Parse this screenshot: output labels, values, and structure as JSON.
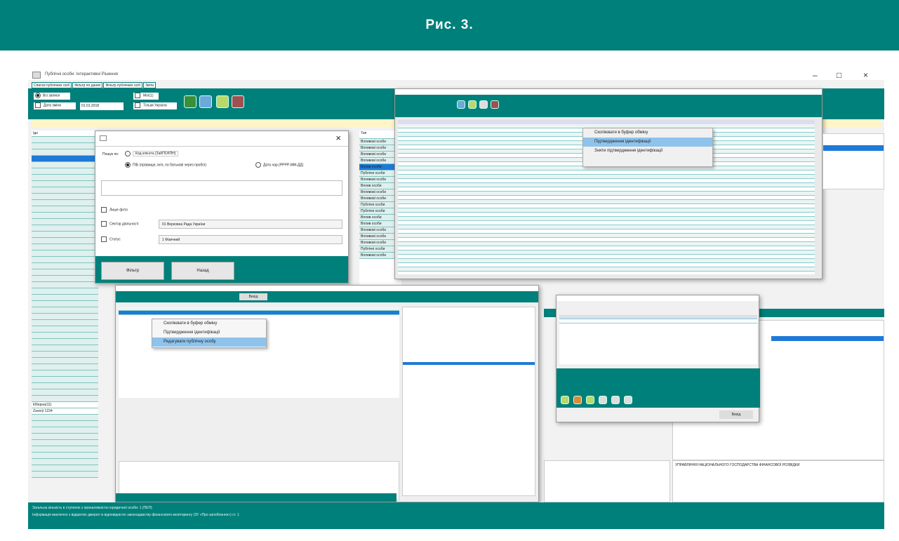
{
  "header": {
    "title": "Рис. 3."
  },
  "app": {
    "title": "Публічні особи: Інтерактивні Рішення",
    "window_controls": [
      "–",
      "□",
      "×"
    ],
    "tabs": [
      "Список публічних осіб",
      "Фільтр по даних",
      "Фільтр публічних осіб",
      "Звіти"
    ],
    "toolbar": {
      "radio_all": "Всі записи",
      "radio_date": "Дата зміни",
      "date_value": "01.01.2018",
      "check_sanc": "Мої(1)",
      "check_ukr": "Тільки Україна"
    },
    "list_header": "Ідн",
    "list_extra": [
      "Кіберна(11)",
      "Zaverj/ 1234"
    ],
    "status_lines": [
      "Загальна кількість в ступенях з приналежністю юридичної особи: 1 (ПЕП)",
      "Інформація виключно з відкритих джерел із відповідністю законодавству фінансового моніторингу (ЗУ «Про запобігання») ст. 1"
    ]
  },
  "filter_dialog": {
    "search_label": "Пошук по:",
    "opt_code": "Код клієнта (ЗаКПО/ІПН)",
    "opt_name": "ПІБ (прізвище, ім'я, по батькові через пробіл)",
    "opt_birth": "Дата нар.(РРРР-ММ-ДД)",
    "check_photo": "Лише фото",
    "check_sector": "Сектор діяльності",
    "sector_value": "01 Верховна Рада України",
    "check_status": "Статус",
    "status_value": "1 Фізичний",
    "btn_filter": "Фільтр",
    "btn_reset": "Назад",
    "close": "×"
  },
  "col_header": "Тип",
  "col_items": [
    "Впливові особи",
    "Впливові особи",
    "Впливові особи",
    "Впливові особи",
    "Вплив особи",
    "Публічні особи",
    "Впливові особи",
    "Вплив особи",
    "Впливові особи",
    "Впливові особи",
    "Публічні особи",
    "Публічні особи",
    "Вплив особи",
    "Вплив особи",
    "Впливові особи",
    "Впливові особи",
    "Впливові особи",
    "Публічні особи",
    "Впливові особи"
  ],
  "context_menu_right": {
    "items": [
      "Скопіювати в буфер обміну",
      "Підтвердження ідентифікації",
      "Зняти підтвердження ідентифікації"
    ],
    "highlight": 1
  },
  "context_menu_left": {
    "items": [
      "Скопіювати в буфер обміну",
      "Підтвердження ідентифікації",
      "Редагувати публічну особу"
    ],
    "highlight": 2
  },
  "bottom_right_text": "УПРАВЛІННЯ НАЦІОНАЛЬНОГО ГОСПОДАРСТВА ФІНАНСОВОЇ РОЗВІДКИ",
  "small_dialog_btn": "Вихід",
  "mid_dialog_btn": "Вихід",
  "colors": {
    "teal": "#00807a",
    "select": "#1e7ad6",
    "highlight": "#8ec3ec"
  }
}
